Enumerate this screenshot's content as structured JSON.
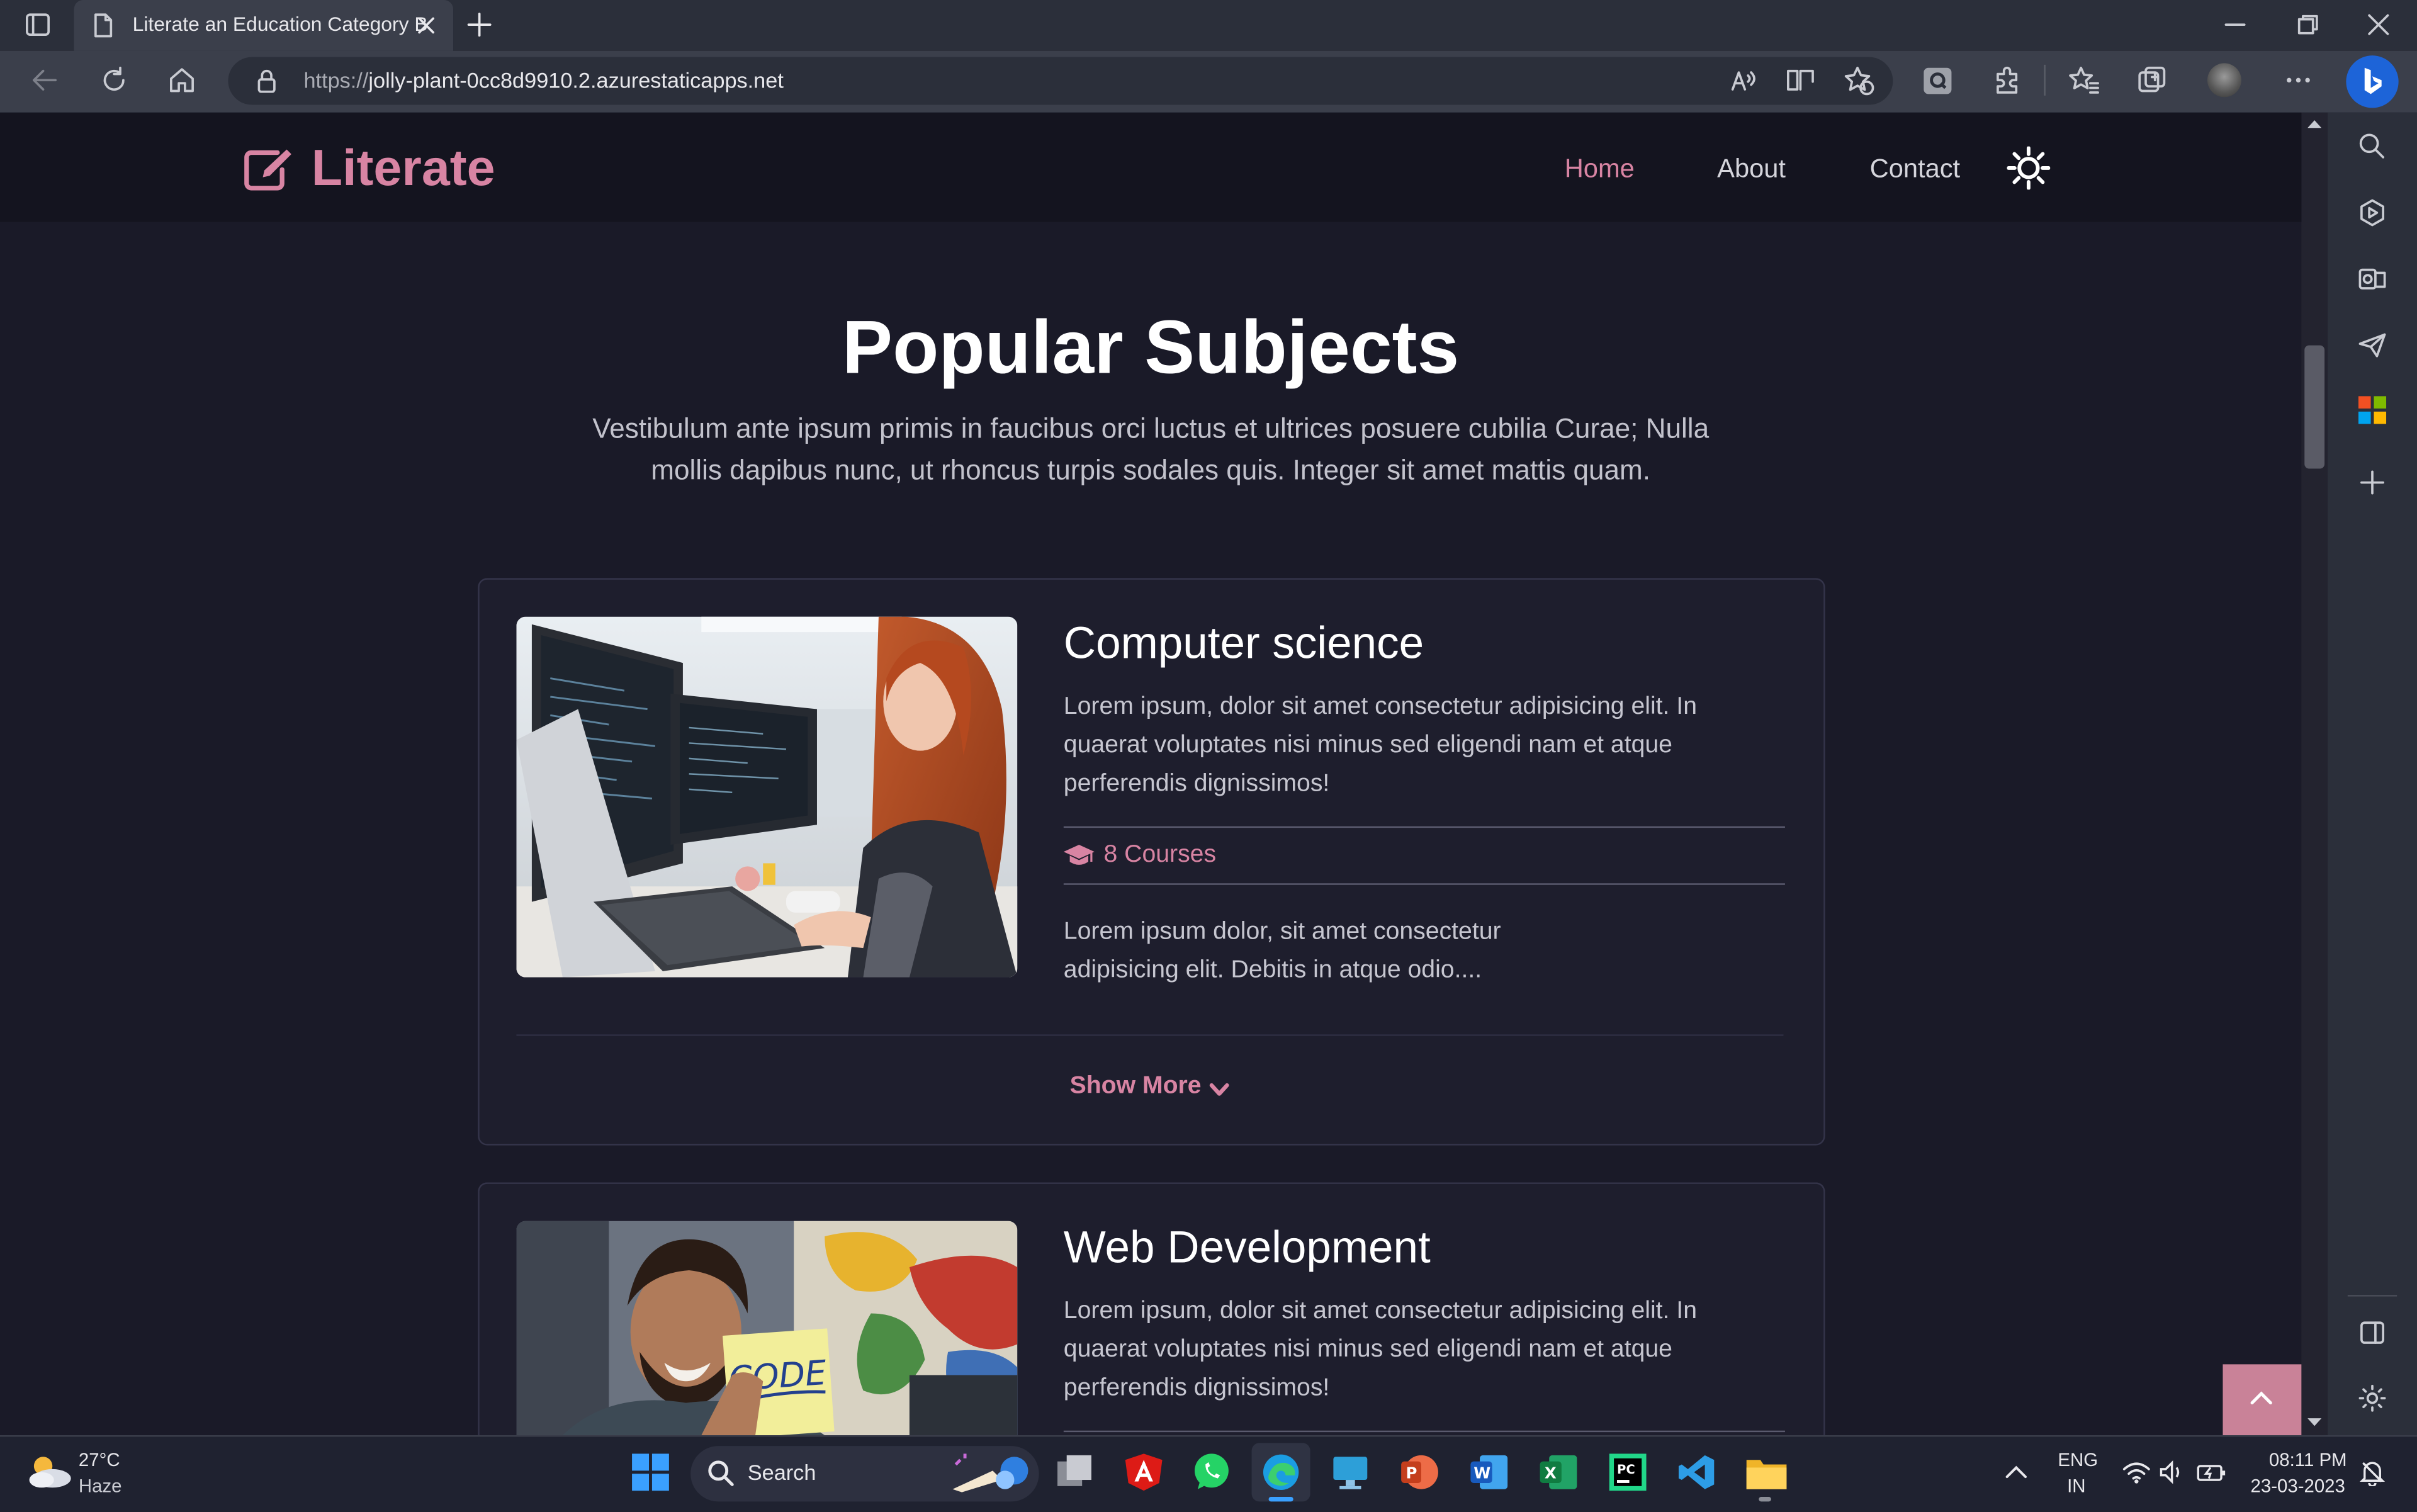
{
  "browser": {
    "tab_title": "Literate an Education Category B",
    "url_host": "https://jolly-plant-0cc8d9910.2.azurestaticapps.net",
    "url_scheme": "https://",
    "url_rest": "jolly-plant-0cc8d9910.2.azurestaticapps.net"
  },
  "site": {
    "brand": "Literate",
    "nav": [
      "Home",
      "About",
      "Contact"
    ],
    "active_nav": "Home",
    "heading": "Popular Subjects",
    "lead": "Vestibulum ante ipsum primis in faucibus orci luctus et ultrices posuere cubilia Curae; Nulla mollis dapibus nunc, ut rhoncus turpis sodales quis. Integer sit amet mattis quam.",
    "cards": [
      {
        "title": "Computer science",
        "text": "Lorem ipsum, dolor sit amet consectetur adipisicing elit. In quaerat voluptates nisi minus sed eligendi nam et atque perferendis dignissimos!",
        "courses": "8 Courses",
        "extra": "Lorem ipsum dolor, sit amet consectetur adipisicing elit. Debitis in atque odio....",
        "show_more": "Show More"
      },
      {
        "title": "Web Development",
        "text": "Lorem ipsum, dolor sit amet consectetur adipisicing elit. In quaerat voluptates nisi minus sed eligendi nam et atque perferendis dignissimos!",
        "sticky_note": "CODE"
      }
    ],
    "accent": "#d884a3"
  },
  "taskbar": {
    "weather_temp": "27°C",
    "weather_desc": "Haze",
    "search_label": "Search",
    "lang_line1": "ENG",
    "lang_line2": "IN",
    "time": "08:11 PM",
    "date": "23-03-2023"
  }
}
